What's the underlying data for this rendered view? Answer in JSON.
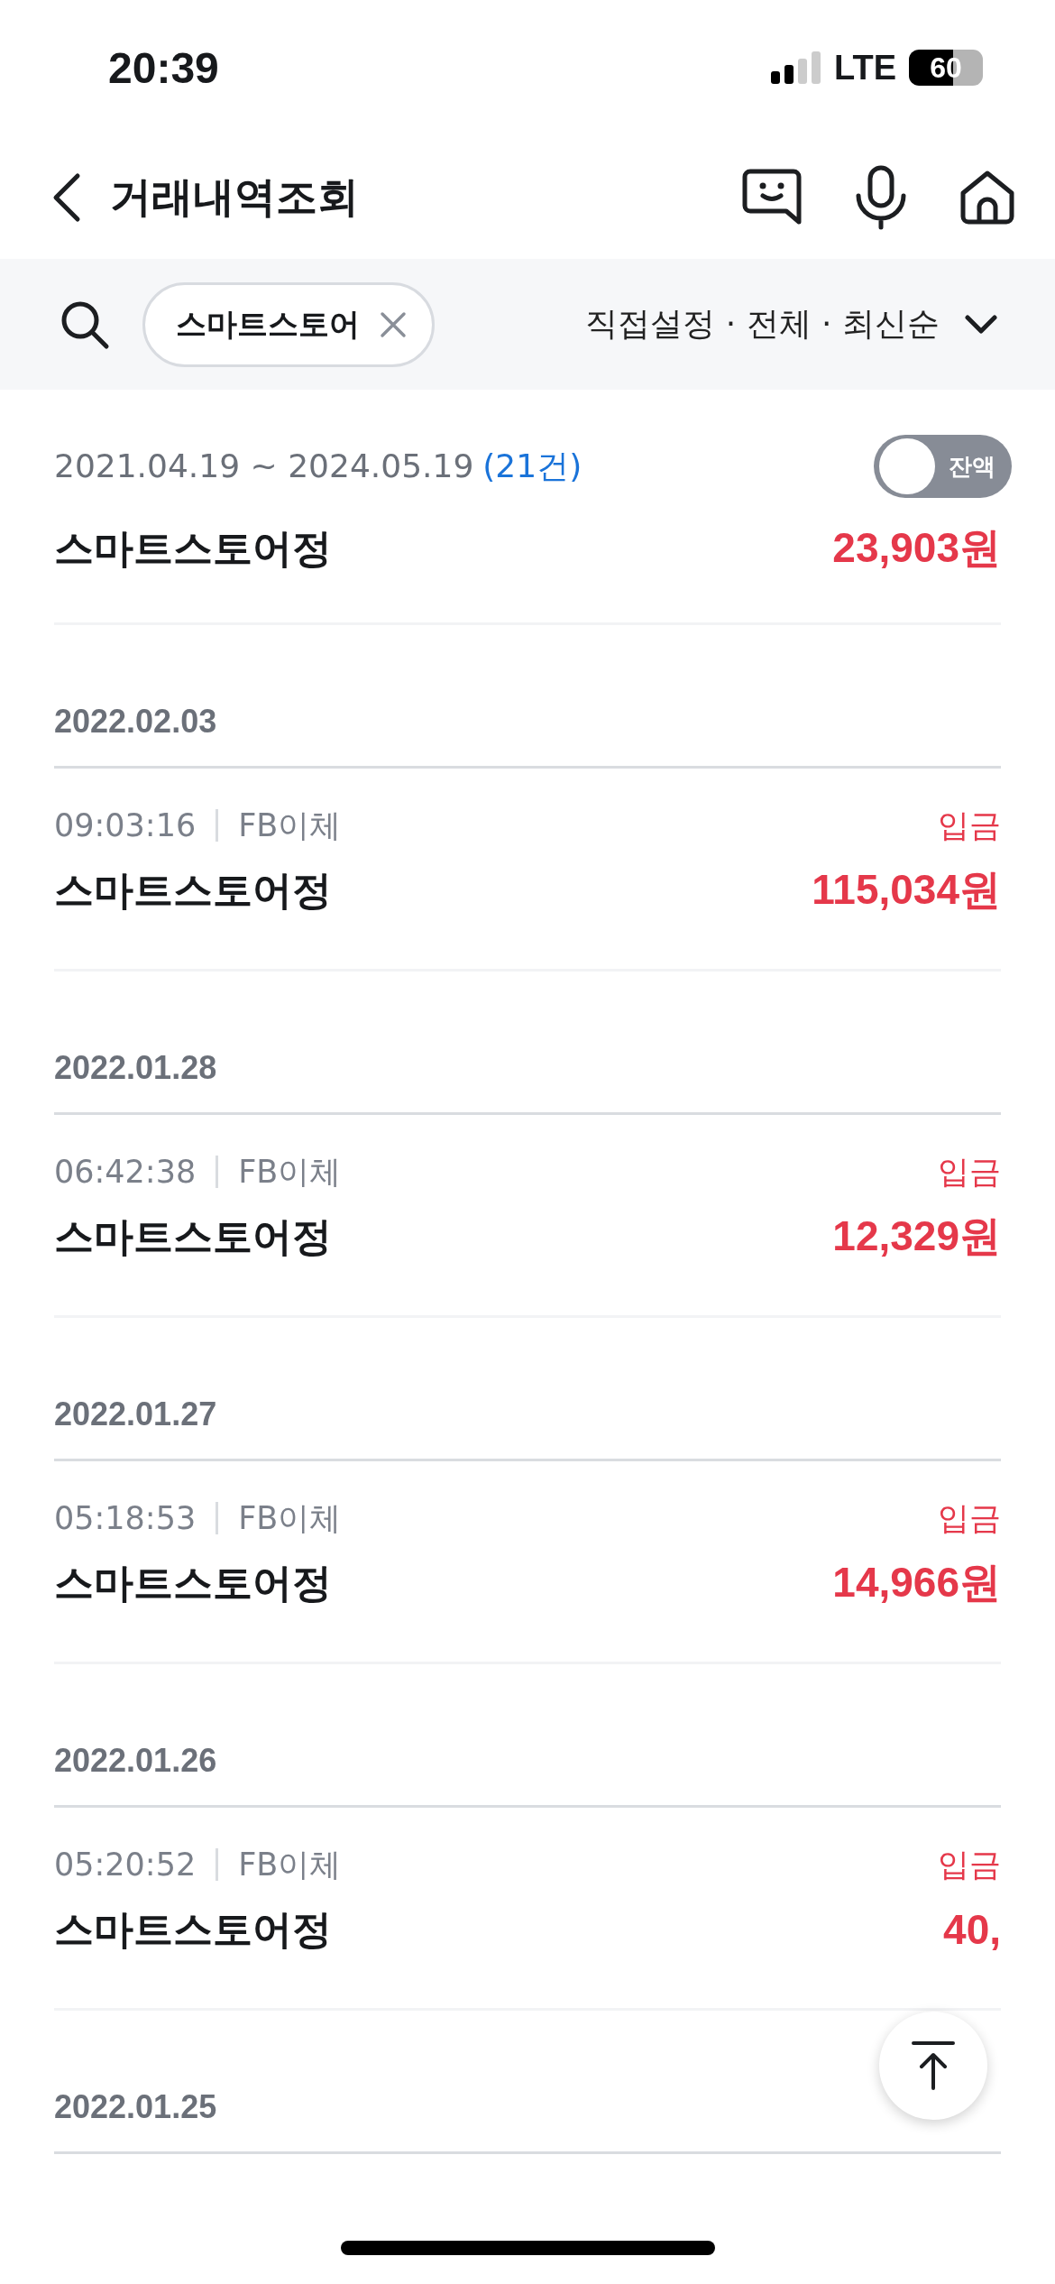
{
  "status_bar": {
    "time": "20:39",
    "network": "LTE",
    "battery": "60"
  },
  "header": {
    "title": "거래내역조회"
  },
  "filter": {
    "chip": "스마트스토어",
    "summary": "직접설정 · 전체 · 최신순"
  },
  "summary": {
    "period": "2021.04.19 ~ 2024.05.19",
    "count": "(21건)",
    "balance_toggle": {
      "label": "잔액",
      "on": false
    },
    "name": "스마트스토어정",
    "total": "23,903원"
  },
  "groups": [
    {
      "date": "2022.02.03",
      "transaction": {
        "time": "09:03:16",
        "method": "FB이체",
        "type": "입금",
        "name": "스마트스토어정",
        "amount": "115,034원"
      }
    },
    {
      "date": "2022.01.28",
      "transaction": {
        "time": "06:42:38",
        "method": "FB이체",
        "type": "입금",
        "name": "스마트스토어정",
        "amount": "12,329원"
      }
    },
    {
      "date": "2022.01.27",
      "transaction": {
        "time": "05:18:53",
        "method": "FB이체",
        "type": "입금",
        "name": "스마트스토어정",
        "amount": "14,966원"
      }
    },
    {
      "date": "2022.01.26",
      "transaction": {
        "time": "05:20:52",
        "method": "FB이체",
        "type": "입금",
        "name": "스마트스토어정",
        "amount": "40,"
      }
    },
    {
      "date": "2022.01.25"
    }
  ]
}
